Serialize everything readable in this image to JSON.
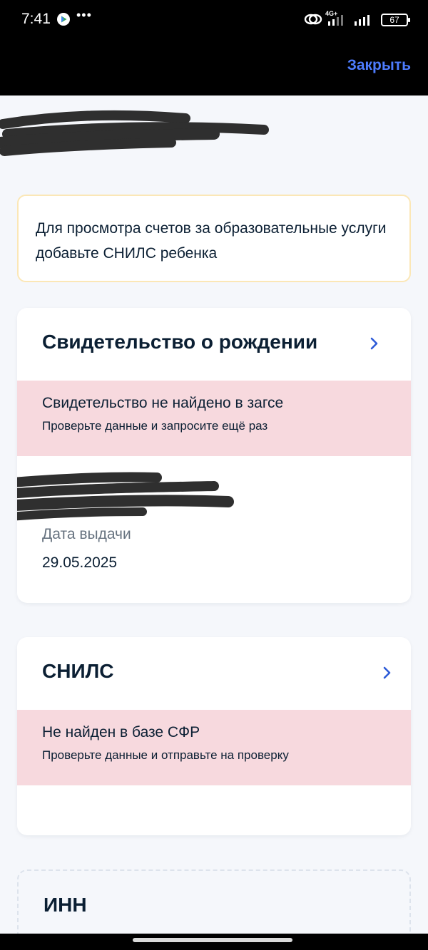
{
  "status_bar": {
    "time": "7:41",
    "network_label": "4G+",
    "battery": "67",
    "icons": [
      "play-store-icon",
      "more-dots-icon",
      "link-icon",
      "signal-icon",
      "battery-icon"
    ]
  },
  "header": {
    "close_label": "Закрыть",
    "accent_color": "#4d7cfe"
  },
  "notice": {
    "text": "Для просмотра счетов за образовательные услуги добавьте СНИЛС ребенка",
    "border_color": "#fbe7b6"
  },
  "cards": [
    {
      "title": "Свидетельство о рождении",
      "error_title": "Свидетельство не найдено в загсе",
      "error_subtitle": "Проверьте данные и запросите ещё раз",
      "field_label": "Дата выдачи",
      "field_value": "29.05.2025"
    },
    {
      "title": "СНИЛС",
      "error_title": "Не найден в базе СФР",
      "error_subtitle": "Проверьте данные и отправьте на проверку"
    },
    {
      "title": "ИНН"
    }
  ],
  "colors": {
    "error_band": "#f7d9de",
    "page_bg": "#f5f7fb",
    "text_primary": "#0b1f33",
    "text_secondary": "#66727f"
  }
}
